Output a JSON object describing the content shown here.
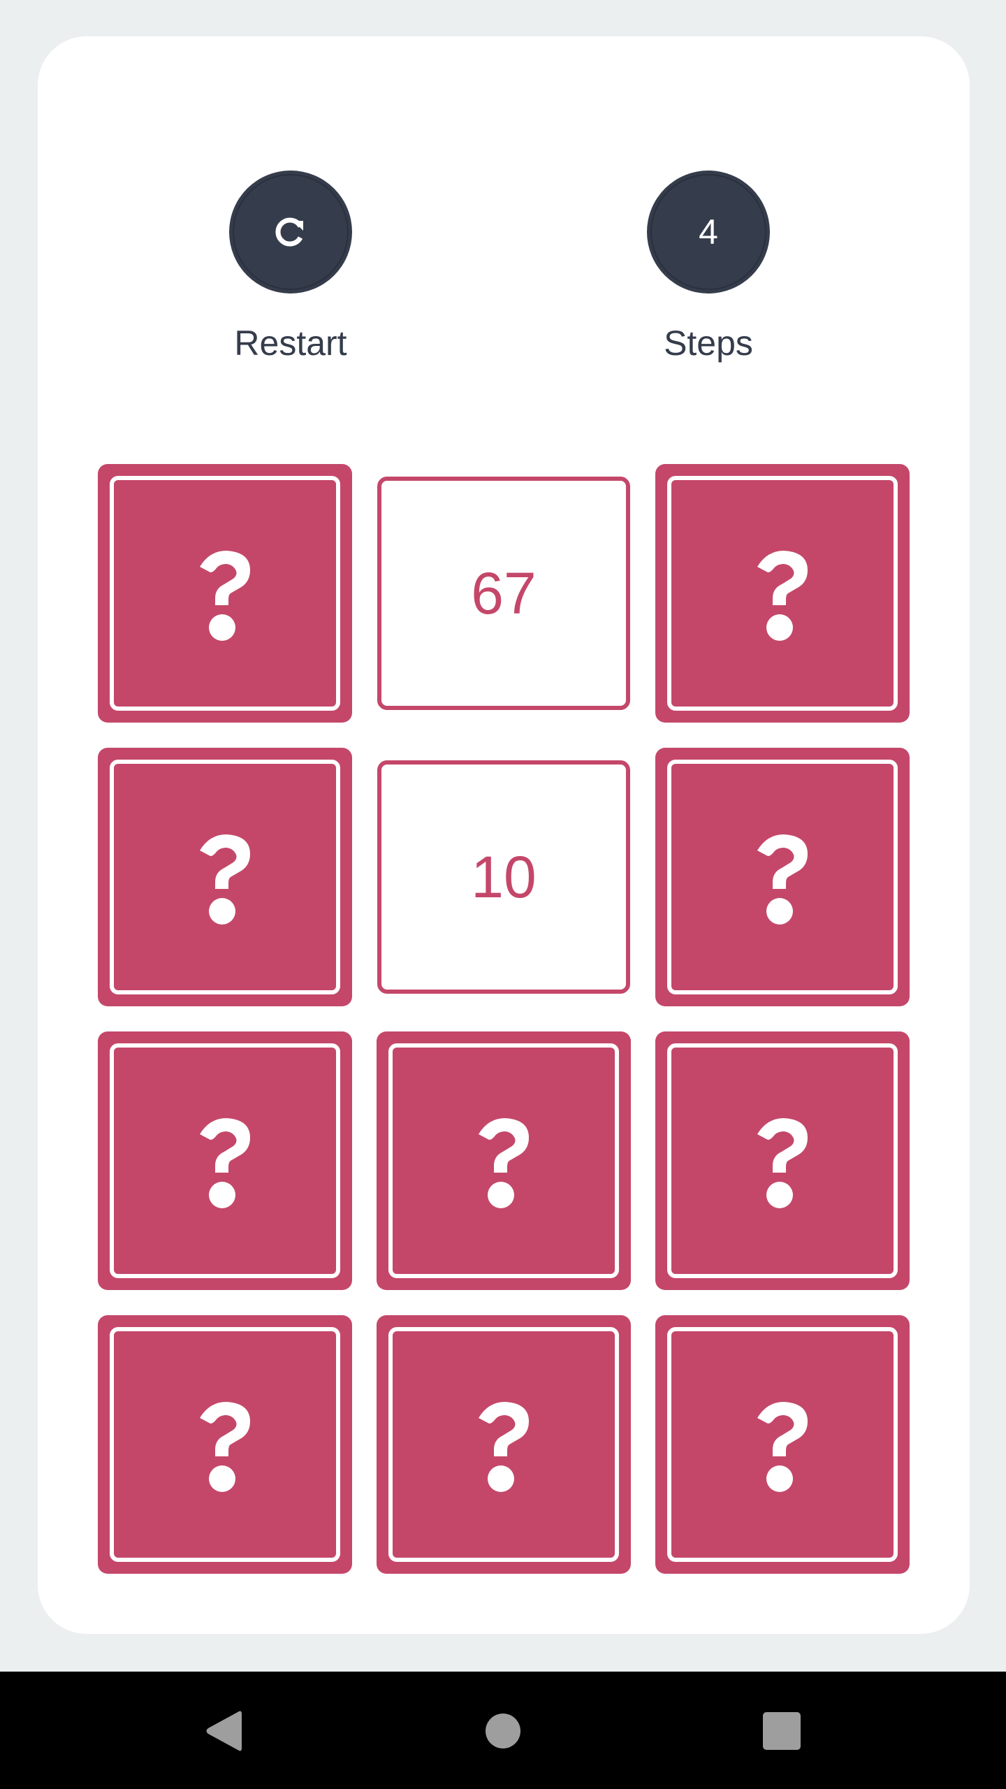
{
  "controls": {
    "restart_label": "Restart",
    "steps_label": "Steps",
    "steps_value": "4"
  },
  "tiles": [
    {
      "state": "hidden",
      "value": ""
    },
    {
      "state": "revealed",
      "value": "67"
    },
    {
      "state": "hidden",
      "value": ""
    },
    {
      "state": "hidden",
      "value": ""
    },
    {
      "state": "revealed",
      "value": "10"
    },
    {
      "state": "hidden",
      "value": ""
    },
    {
      "state": "hidden",
      "value": ""
    },
    {
      "state": "hidden",
      "value": ""
    },
    {
      "state": "hidden",
      "value": ""
    },
    {
      "state": "hidden",
      "value": ""
    },
    {
      "state": "hidden",
      "value": ""
    },
    {
      "state": "hidden",
      "value": ""
    }
  ],
  "icons": {
    "restart": "restart-icon",
    "hidden_tile": "question-mark-icon",
    "nav_back": "back-triangle-icon",
    "nav_home": "home-circle-icon",
    "nav_recents": "recents-square-icon"
  },
  "colors": {
    "background": "#eceff0",
    "panel": "#ffffff",
    "accent": "#c4476a",
    "control_dark": "#353c4b",
    "navbar": "#000000"
  }
}
